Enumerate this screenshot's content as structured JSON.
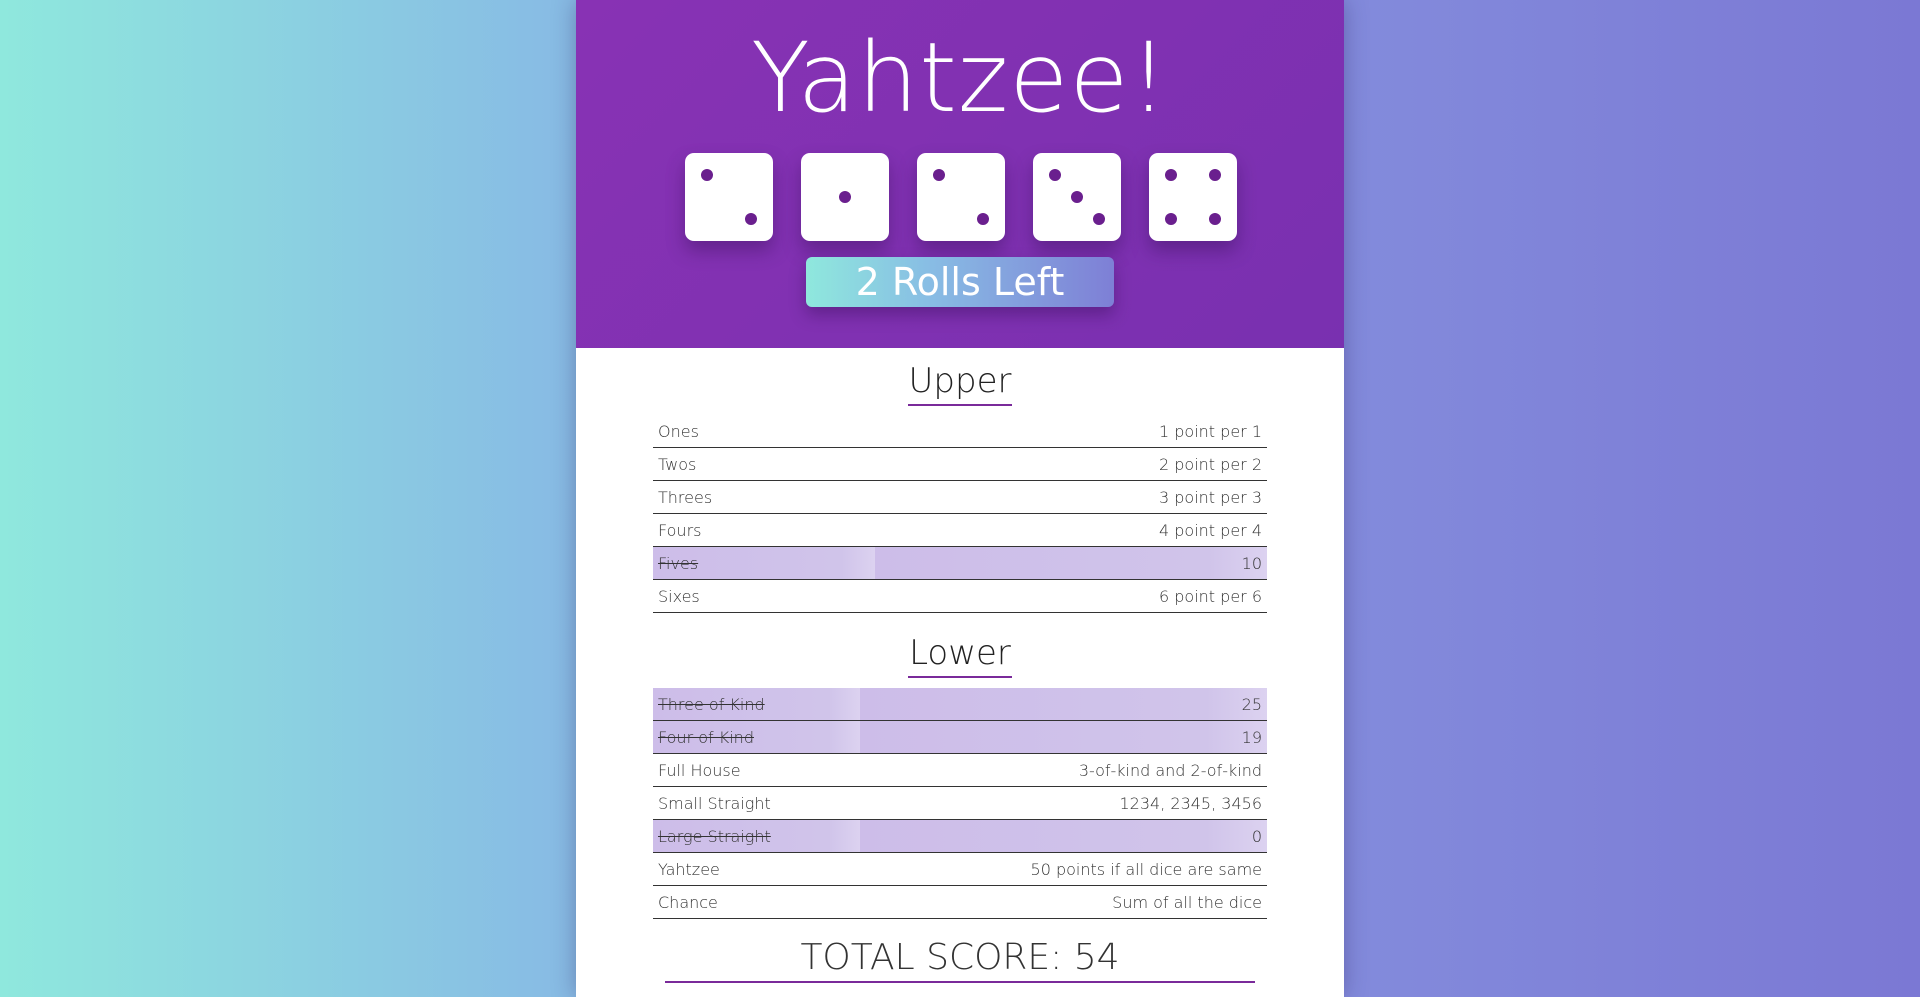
{
  "title": "Yahtzee!",
  "dice": [
    2,
    1,
    2,
    3,
    4
  ],
  "roll_button_label": "2 Rolls Left",
  "upper": {
    "title": "Upper",
    "rows": [
      {
        "name": "Ones",
        "score": "1 point per 1",
        "used": false
      },
      {
        "name": "Twos",
        "score": "2 point per 2",
        "used": false
      },
      {
        "name": "Threes",
        "score": "3 point per 3",
        "used": false
      },
      {
        "name": "Fours",
        "score": "4 point per 4",
        "used": false
      },
      {
        "name": "Fives",
        "score": "10",
        "used": true
      },
      {
        "name": "Sixes",
        "score": "6 point per 6",
        "used": false
      }
    ]
  },
  "lower": {
    "title": "Lower",
    "rows": [
      {
        "name": "Three of Kind",
        "score": "25",
        "used": true
      },
      {
        "name": "Four of Kind",
        "score": "19",
        "used": true
      },
      {
        "name": "Full House",
        "score": "3-of-kind and 2-of-kind",
        "used": false
      },
      {
        "name": "Small Straight",
        "score": "1234, 2345, 3456",
        "used": false
      },
      {
        "name": "Large Straight",
        "score": "0",
        "used": true
      },
      {
        "name": "Yahtzee",
        "score": "50 points if all dice are same",
        "used": false
      },
      {
        "name": "Chance",
        "score": "Sum of all the dice",
        "used": false
      }
    ]
  },
  "total_score": "TOTAL SCORE: 54",
  "colors": {
    "header": "#8832b4",
    "pip": "#6a1f8e",
    "used_row": "#cdbde9",
    "underline": "#7a2a9a"
  }
}
